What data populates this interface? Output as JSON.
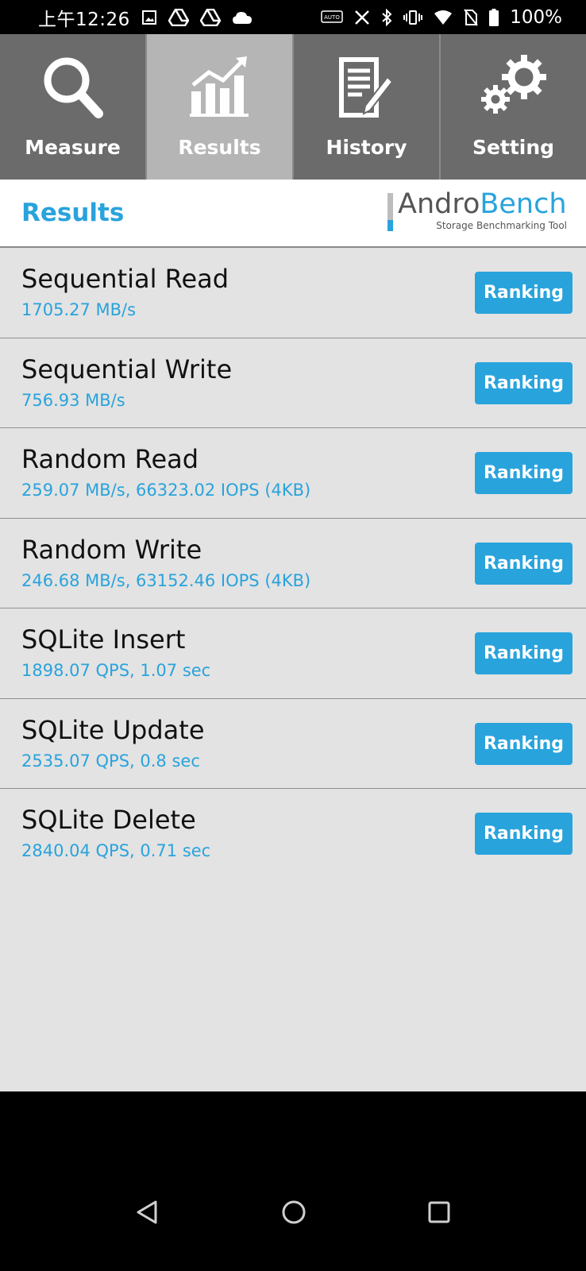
{
  "status_bar": {
    "time": "上午12:26",
    "battery": "100%",
    "left_icons": [
      "image-icon",
      "drive-icon",
      "drive-icon",
      "cloud-icon"
    ],
    "right_icons": [
      "auto-icon",
      "nfc-off-icon",
      "bluetooth-icon",
      "vibrate-icon",
      "wifi-icon",
      "no-sim-icon",
      "battery-icon"
    ]
  },
  "tabs": [
    {
      "label": "Measure",
      "icon": "search-icon",
      "active": false
    },
    {
      "label": "Results",
      "icon": "chart-icon",
      "active": true
    },
    {
      "label": "History",
      "icon": "document-icon",
      "active": false
    },
    {
      "label": "Setting",
      "icon": "gear-icon",
      "active": false
    }
  ],
  "header": {
    "title": "Results",
    "logo_andro": "Andro",
    "logo_bench": "Bench",
    "logo_tagline": "Storage Benchmarking Tool"
  },
  "results": [
    {
      "name": "Sequential Read",
      "value": "1705.27 MB/s",
      "button": "Ranking"
    },
    {
      "name": "Sequential Write",
      "value": "756.93 MB/s",
      "button": "Ranking"
    },
    {
      "name": "Random Read",
      "value": "259.07 MB/s, 66323.02 IOPS (4KB)",
      "button": "Ranking"
    },
    {
      "name": "Random Write",
      "value": "246.68 MB/s, 63152.46 IOPS (4KB)",
      "button": "Ranking"
    },
    {
      "name": "SQLite Insert",
      "value": "1898.07 QPS, 1.07 sec",
      "button": "Ranking"
    },
    {
      "name": "SQLite Update",
      "value": "2535.07 QPS, 0.8 sec",
      "button": "Ranking"
    },
    {
      "name": "SQLite Delete",
      "value": "2840.04 QPS, 0.71 sec",
      "button": "Ranking"
    }
  ],
  "colors": {
    "accent": "#29a3dc",
    "tab_bg": "#6b6b6b",
    "tab_active_bg": "#b5b5b5",
    "list_bg": "#e3e3e3"
  }
}
